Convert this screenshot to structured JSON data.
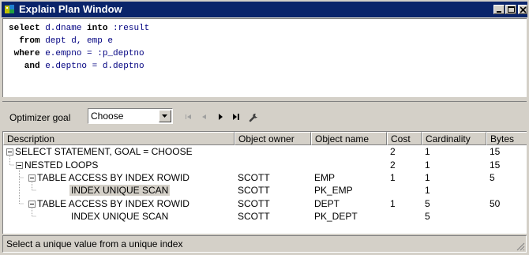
{
  "window": {
    "title": "Explain Plan Window"
  },
  "sql": [
    {
      "kw": "select",
      "rest": " d.dname ",
      "kw2": "into",
      "rest2": " :result"
    },
    {
      "kw": "  from",
      "rest": " dept d, emp e",
      "kw2": "",
      "rest2": ""
    },
    {
      "kw": " where",
      "rest": " e.empno = :p_deptno",
      "kw2": "",
      "rest2": ""
    },
    {
      "kw": "   and",
      "rest": " e.deptno = d.deptno",
      "kw2": "",
      "rest2": ""
    }
  ],
  "toolbar": {
    "optimizer_label": "Optimizer goal",
    "optimizer_value": "Choose"
  },
  "grid": {
    "columns": [
      "Description",
      "Object owner",
      "Object name",
      "Cost",
      "Cardinality",
      "Bytes"
    ],
    "rows": [
      {
        "description": "SELECT STATEMENT, GOAL = CHOOSE",
        "owner": "",
        "object": "",
        "cost": "2",
        "cardinality": "1",
        "bytes": "15"
      },
      {
        "description": "NESTED LOOPS",
        "owner": "",
        "object": "",
        "cost": "2",
        "cardinality": "1",
        "bytes": "15"
      },
      {
        "description": "TABLE ACCESS BY INDEX ROWID",
        "owner": "SCOTT",
        "object": "EMP",
        "cost": "1",
        "cardinality": "1",
        "bytes": "5"
      },
      {
        "description": "INDEX UNIQUE SCAN",
        "owner": "SCOTT",
        "object": "PK_EMP",
        "cost": "",
        "cardinality": "1",
        "bytes": ""
      },
      {
        "description": "TABLE ACCESS BY INDEX ROWID",
        "owner": "SCOTT",
        "object": "DEPT",
        "cost": "1",
        "cardinality": "5",
        "bytes": "50"
      },
      {
        "description": "INDEX UNIQUE SCAN",
        "owner": "SCOTT",
        "object": "PK_DEPT",
        "cost": "",
        "cardinality": "5",
        "bytes": ""
      }
    ]
  },
  "status": {
    "text": "Select a unique value from a unique index"
  },
  "icons": {
    "app": "app-icon",
    "first": "first-icon",
    "prev": "prev-icon",
    "next": "next-icon",
    "last": "last-icon",
    "settings": "wrench-icon"
  },
  "colors": {
    "titlebar": "#0a246a",
    "face": "#d4d0c8",
    "keyword": "#000000",
    "identifier": "#000080"
  }
}
